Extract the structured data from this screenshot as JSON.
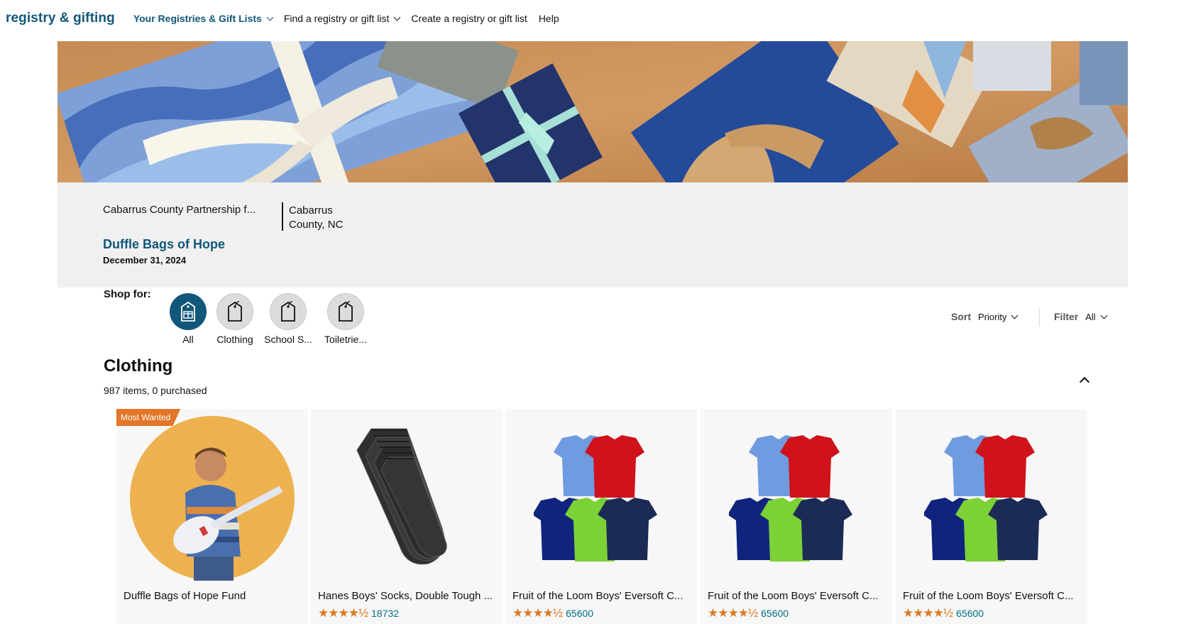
{
  "nav": {
    "brand": "registry & gifting",
    "links": [
      {
        "label": "Your Registries & Gift Lists",
        "dropdown": true
      },
      {
        "label": "Find a registry or gift list",
        "dropdown": true
      },
      {
        "label": "Create a registry or gift list",
        "dropdown": false
      },
      {
        "label": "Help",
        "dropdown": false
      }
    ]
  },
  "registry": {
    "org": "Cabarrus County Partnership f...",
    "location": "Cabarrus County, NC",
    "name": "Duffle Bags of Hope",
    "date": "December 31, 2024"
  },
  "shop": {
    "label": "Shop for:",
    "categories": [
      {
        "label": "All",
        "icon": "gift-tag-icon",
        "active": true
      },
      {
        "label": "Clothing",
        "icon": "tag-icon",
        "active": false
      },
      {
        "label": "School S...",
        "icon": "tag-icon",
        "active": false
      },
      {
        "label": "Toiletrie...",
        "icon": "tag-icon",
        "active": false
      }
    ]
  },
  "sort": {
    "label": "Sort",
    "value": "Priority"
  },
  "filter": {
    "label": "Filter",
    "value": "All"
  },
  "section": {
    "title": "Clothing",
    "count": "987 items, 0 purchased"
  },
  "products": [
    {
      "badge": "Most Wanted",
      "title": "Duffle Bags of Hope Fund",
      "image": "child-guitar-photo",
      "rating": null,
      "reviews": null
    },
    {
      "badge": null,
      "title": "Hanes Boys' Socks, Double Tough ...",
      "image": "black-socks-photo",
      "rating": 4.5,
      "reviews": "18732"
    },
    {
      "badge": null,
      "title": "Fruit of the Loom Boys' Eversoft C...",
      "image": "tshirts-photo",
      "rating": 4.5,
      "reviews": "65600"
    },
    {
      "badge": null,
      "title": "Fruit of the Loom Boys' Eversoft C...",
      "image": "tshirts-photo",
      "rating": 4.5,
      "reviews": "65600"
    },
    {
      "badge": null,
      "title": "Fruit of the Loom Boys' Eversoft C...",
      "image": "tshirts-photo",
      "rating": 4.5,
      "reviews": "65600"
    }
  ],
  "colors": {
    "brand": "#11577a",
    "link": "#007185",
    "star": "#de7921",
    "badge": "#e37627",
    "panel": "#f0f0f0"
  }
}
